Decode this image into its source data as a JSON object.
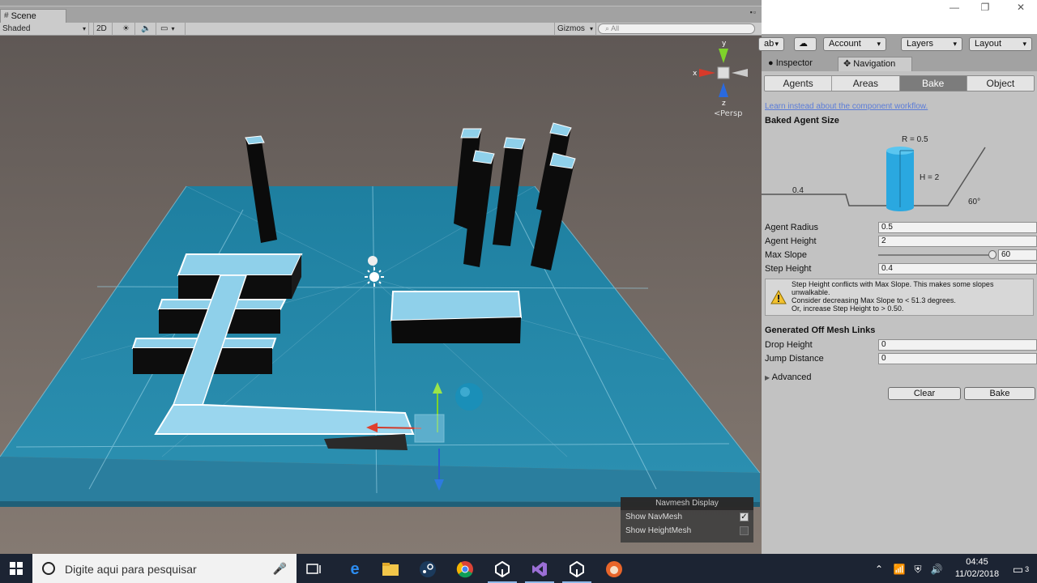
{
  "scene": {
    "tab_label": "Scene",
    "toolbar": {
      "shading_mode": "Shaded",
      "mode_2d": "2D",
      "gizmos_label": "Gizmos",
      "search_placeholder": "All"
    },
    "gizmo": {
      "x_label": "x",
      "y_label": "y",
      "z_label": "z",
      "projection": "Persp"
    },
    "navmesh_display": {
      "title": "Navmesh Display",
      "rows": [
        {
          "label": "Show NavMesh",
          "checked": true
        },
        {
          "label": "Show HeightMesh",
          "checked": false
        }
      ]
    }
  },
  "topbar": {
    "collab_label": "ab",
    "account_label": "Account",
    "layers_label": "Layers",
    "layout_label": "Layout"
  },
  "panel_tabs": {
    "inspector": "Inspector",
    "navigation": "Navigation"
  },
  "navigation": {
    "tabs": [
      "Agents",
      "Areas",
      "Bake",
      "Object"
    ],
    "active_tab": "Bake",
    "link_text": "Learn instead about the component workflow.",
    "baked_agent_size": {
      "heading": "Baked Agent Size",
      "radius_label": "R = 0.5",
      "height_label": "H = 2",
      "step_label": "0.4",
      "slope_label": "60°"
    },
    "fields": {
      "agent_radius": {
        "label": "Agent Radius",
        "value": "0.5"
      },
      "agent_height": {
        "label": "Agent Height",
        "value": "2"
      },
      "max_slope": {
        "label": "Max Slope",
        "value": "60"
      },
      "step_height": {
        "label": "Step Height",
        "value": "0.4"
      }
    },
    "warning": {
      "line1": "Step Height conflicts with Max Slope. This makes some slopes unwalkable.",
      "line2": "Consider decreasing Max Slope to < 51.3 degrees.",
      "line3": "Or, increase Step Height to > 0.50."
    },
    "off_mesh": {
      "heading": "Generated Off Mesh Links",
      "drop_height": {
        "label": "Drop Height",
        "value": "0"
      },
      "jump_distance": {
        "label": "Jump Distance",
        "value": "0"
      }
    },
    "advanced_label": "Advanced",
    "clear_button": "Clear",
    "bake_button": "Bake"
  },
  "taskbar": {
    "search_text": "Digite aqui para pesquisar",
    "time": "04:45",
    "date": "11/02/2018",
    "notification_count": "3"
  },
  "colors": {
    "floor": "#2c8aa8",
    "navmesh": "#8fd0ea",
    "selected_tab": "#7c7c7c",
    "taskbar": "#1c2433"
  }
}
